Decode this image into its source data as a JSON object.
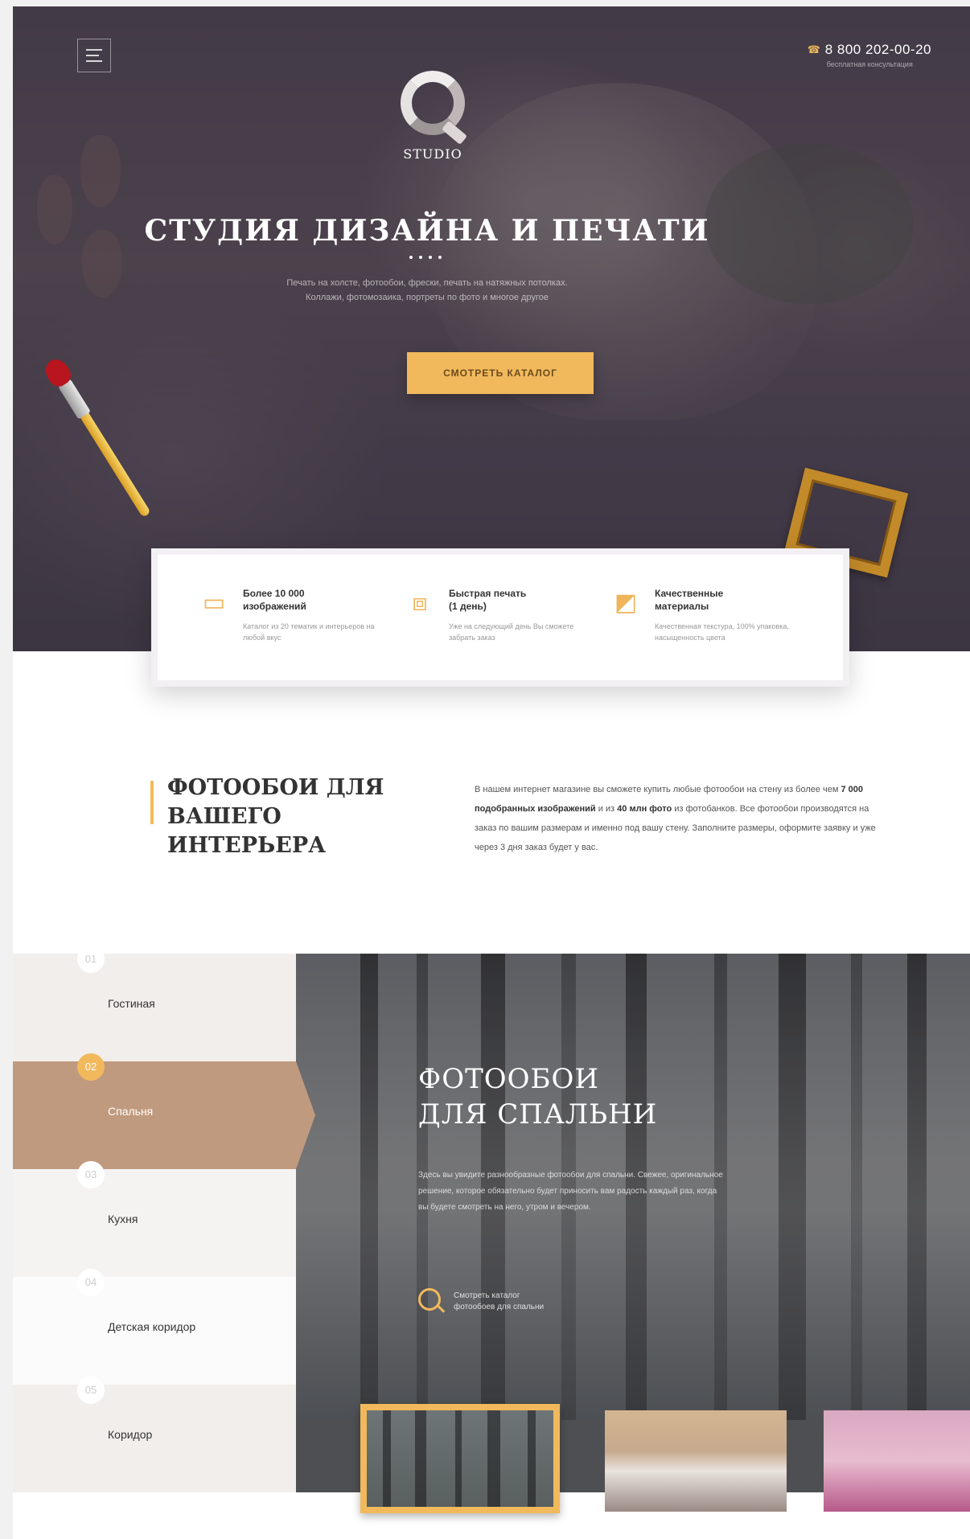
{
  "header": {
    "phone_number": "8 800 202-00-20",
    "phone_note": "бесплатная консультация",
    "logo_letter": "Q",
    "logo_text": "STUDIO"
  },
  "hero": {
    "title": "СТУДИЯ ДИЗАЙНА И ПЕЧАТИ",
    "description_line1": "Печать на холсте, фотообои, фрески, печать на натяжных потолках.",
    "description_line2": "Коллажи, фотомозаика, портреты по фото и многое другое",
    "cta_label": "СМОТРЕТЬ КАТАЛОГ"
  },
  "features": [
    {
      "title": "Более 10 000 изображений",
      "description": "Каталог из 20 тематик и интерьеров на любой вкус",
      "icon": "image-tray-icon"
    },
    {
      "title": "Быстрая печать (1 день)",
      "description": "Уже на следующий день Вы сможете забрать заказ",
      "icon": "print-frame-icon"
    },
    {
      "title": "Качественные материалы",
      "description": "Качественная текстура, 100% упаковка, насыщенность цвета",
      "icon": "swatch-icon"
    }
  ],
  "about": {
    "title_line1": "ФОТООБОИ ДЛЯ",
    "title_line2": "ВАШЕГО ИНТЕРЬЕРА",
    "text_part1": "В нашем интернет магазине вы сможете купить любые фотообои на стену из более чем ",
    "text_bold1": "7 000 подобранных изображений",
    "text_part2": " и из ",
    "text_bold2": "40 млн фото",
    "text_part3": " из фотобанков. Все фотообои производятся на заказ по вашим размерам и именно под вашу стену. Заполните размеры, оформите заявку и уже через 3 дня заказ будет у вас."
  },
  "categories": [
    {
      "num": "01",
      "label": "Гостиная"
    },
    {
      "num": "02",
      "label": "Спальня"
    },
    {
      "num": "03",
      "label": "Кухня"
    },
    {
      "num": "04",
      "label": "Детская коридор"
    },
    {
      "num": "05",
      "label": "Коридор"
    }
  ],
  "bedroom": {
    "title_line1": "ФОТООБОИ",
    "title_line2": "ДЛЯ СПАЛЬНИ",
    "text": "Здесь вы увидите разнообразные фотообои для спальни. Свежее, оригинальное решение, которое обязательно будет приносить вам радость каждый раз, когда вы будете смотреть на него, утром и вечером.",
    "link_line1": "Смотреть каталог",
    "link_line2": "фотообоев для спальни"
  },
  "colors": {
    "accent": "#f1b95c",
    "active_category": "#c09a7f"
  }
}
